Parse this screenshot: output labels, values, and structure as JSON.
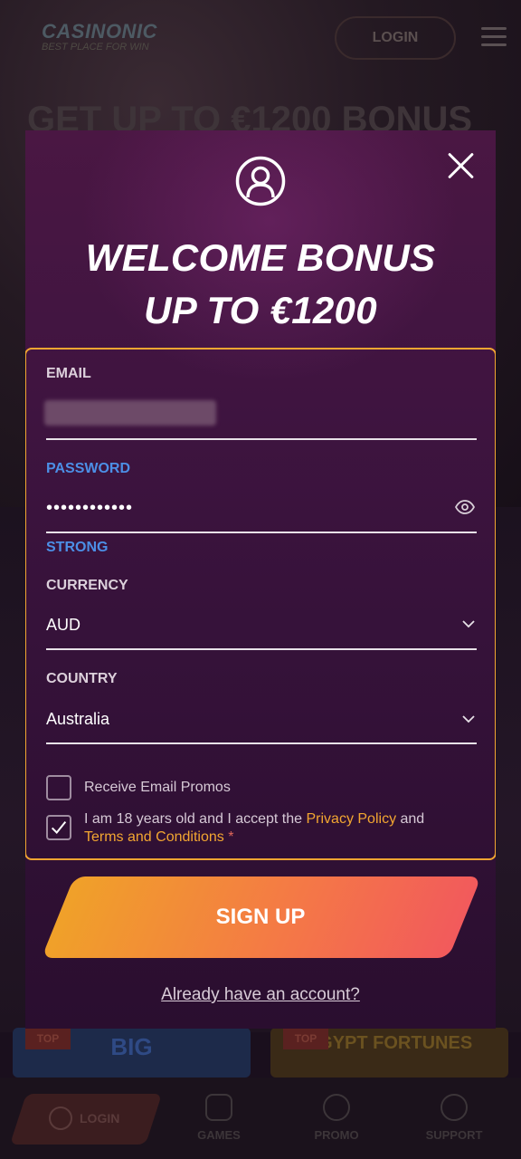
{
  "background": {
    "logo": {
      "name": "CASINONIC",
      "tagline": "BEST PLACE FOR WIN"
    },
    "login_label": "LOGIN",
    "headline": "GET UP TO €1200 BONUS",
    "tiles": [
      {
        "badge": "TOP",
        "name": "BIG"
      },
      {
        "badge": "TOP",
        "name": "EGYPT FORTUNES"
      }
    ],
    "bottom_nav": [
      {
        "label": "LOGIN",
        "icon": "user-icon"
      },
      {
        "label": "GAMES",
        "icon": "dice-icon"
      },
      {
        "label": "PROMO",
        "icon": "coin-icon"
      },
      {
        "label": "SUPPORT",
        "icon": "chat-icon"
      }
    ]
  },
  "modal": {
    "headline_line1": "WELCOME BONUS",
    "headline_line2": "UP TO €1200",
    "form": {
      "email_label": "EMAIL",
      "password_label": "PASSWORD",
      "password_value": "••••••••••••",
      "password_strength": "STRONG",
      "currency_label": "CURRENCY",
      "currency_value": "AUD",
      "country_label": "COUNTRY",
      "country_value": "Australia",
      "promo_checkbox_label": "Receive Email Promos",
      "promo_checked": false,
      "terms_text_before": "I am 18 years old and I accept the ",
      "privacy_link": "Privacy Policy",
      "terms_text_and": " and",
      "terms_link": "Terms and Conditions",
      "terms_required_mark": " *",
      "terms_checked": true
    },
    "signup_label": "SIGN UP",
    "account_link": "Already have an account?"
  },
  "colors": {
    "accent": "#f2a631",
    "password_strength": "#4c8fe6",
    "button_gradient_start": "#f0a129",
    "button_gradient_end": "#f25a5c",
    "modal_bg": "#3f1440"
  }
}
